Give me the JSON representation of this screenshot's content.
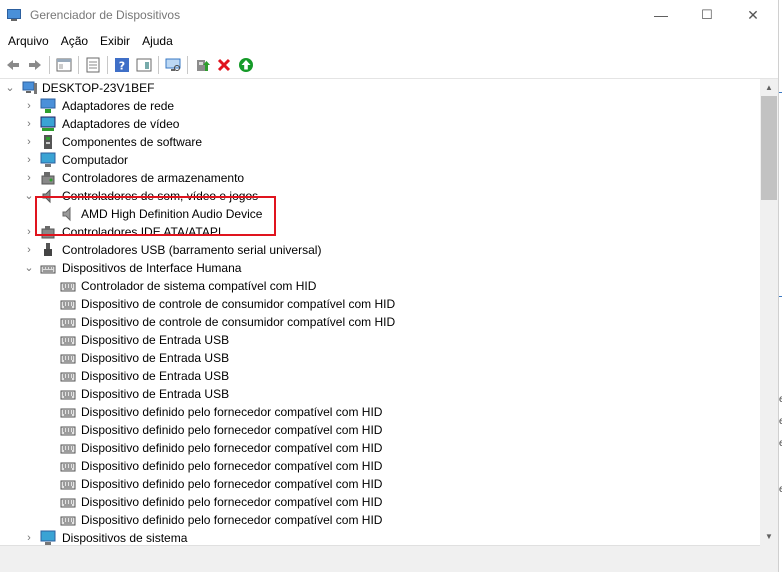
{
  "window": {
    "title": "Gerenciador de Dispositivos",
    "controls": {
      "minimize": "—",
      "maximize": "☐",
      "close": "✕"
    }
  },
  "menu": [
    "Arquivo",
    "Ação",
    "Exibir",
    "Ajuda"
  ],
  "toolbar": [
    "back-icon",
    "forward-icon",
    "show-hide-console-icon",
    "properties-icon",
    "help-icon",
    "action-pane-icon",
    "scan-hardware-icon",
    "update-driver-icon",
    "uninstall-icon",
    "enable-device-icon"
  ],
  "tree": {
    "root": "DESKTOP-23V1BEF",
    "categories": [
      {
        "label": "Adaptadores de rede",
        "icon": "network-adapter-icon"
      },
      {
        "label": "Adaptadores de vídeo",
        "icon": "display-adapter-icon"
      },
      {
        "label": "Componentes de software",
        "icon": "software-component-icon"
      },
      {
        "label": "Computador",
        "icon": "computer-icon"
      },
      {
        "label": "Controladores de armazenamento",
        "icon": "storage-controller-icon"
      },
      {
        "label": "Controladores de som, vídeo e jogos",
        "icon": "speaker-icon"
      },
      {
        "label": "Controladores IDE ATA/ATAPI",
        "icon": "ide-controller-icon"
      },
      {
        "label": "Controladores USB (barramento serial universal)",
        "icon": "usb-icon"
      },
      {
        "label": "Dispositivos de Interface Humana",
        "icon": "hid-icon"
      },
      {
        "label": "Dispositivos de sistema",
        "icon": "system-device-icon"
      }
    ],
    "sound_children": [
      "AMD High Definition Audio Device"
    ],
    "hid_children": [
      "Controlador de sistema compatível com HID",
      "Dispositivo de controle de consumidor compatível com HID",
      "Dispositivo de controle de consumidor compatível com HID",
      "Dispositivo de Entrada USB",
      "Dispositivo de Entrada USB",
      "Dispositivo de Entrada USB",
      "Dispositivo de Entrada USB",
      "Dispositivo definido pelo fornecedor compatível com HID",
      "Dispositivo definido pelo fornecedor compatível com HID",
      "Dispositivo definido pelo fornecedor compatível com HID",
      "Dispositivo definido pelo fornecedor compatível com HID",
      "Dispositivo definido pelo fornecedor compatível com HID",
      "Dispositivo definido pelo fornecedor compatível com HID",
      "Dispositivo definido pelo fornecedor compatível com HID"
    ]
  },
  "side_glyphs": [
    "e",
    "e",
    "e",
    "e"
  ],
  "colors": {
    "highlight": "#e0141e",
    "accent": "#3a78c3"
  }
}
